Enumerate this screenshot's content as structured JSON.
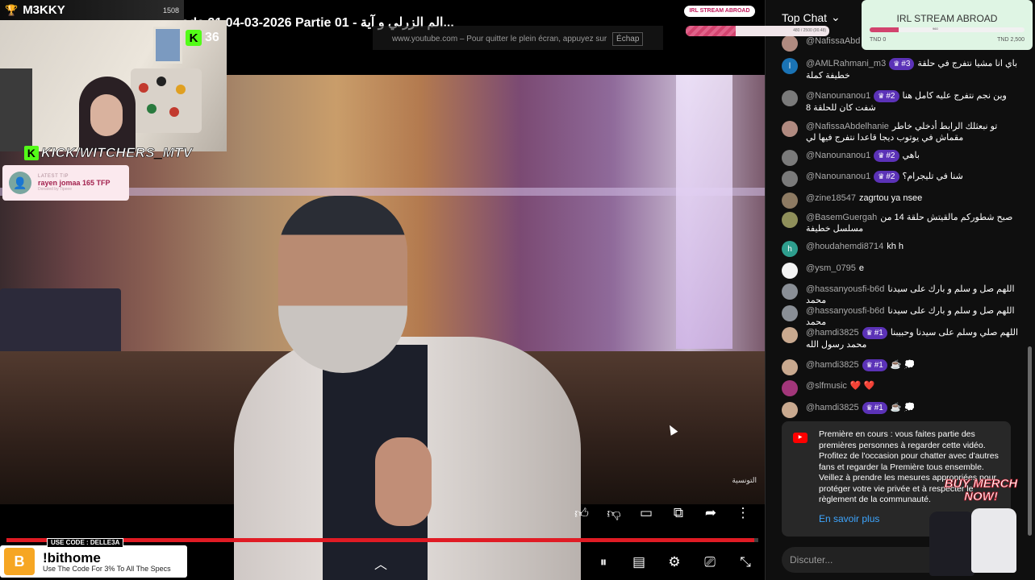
{
  "video": {
    "title": "Fekrel Sami Fehri S06 Episode 21 04-03-2026 Partie 01 - الم الزرلي و آية...",
    "fullscreen_hint": "www.youtube.com – Pour quitter le plein écran, appuyez sur",
    "fullscreen_key": "Échap",
    "watermark": "التونسية",
    "progress_pct": 99.5
  },
  "stream_overlay": {
    "streamer_name": "M3KKY",
    "streamer_count": "1508",
    "kick_viewers": "36",
    "kick_handle": "KICK/WITCHERS_MTV",
    "latest_tip_label": "LATEST TIP",
    "latest_tip_value": "rayen jomaa 165 TFP",
    "latest_tip_sub": "Donated by Tipeee",
    "irl_mini_title": "IRL STREAM ABROAD",
    "irl_mini_amount": "480 / 2500 (00.48)",
    "irl_mini_pct": 35,
    "irl_title": "IRL STREAM ABROAD",
    "irl_bar_text": "960",
    "irl_pct": 19,
    "irl_min": "TND 0",
    "irl_max": "TND 2,500"
  },
  "promo": {
    "use_code": "USE CODE : DELLE3A",
    "brand": "!bithome",
    "tagline": "Use The Code For 3% To All The Specs",
    "logo_text": "B"
  },
  "chat": {
    "header": "Top Chat",
    "messages": [
      {
        "user": "@NafissaAbd",
        "badge": "",
        "text": "",
        "avatar_color": "#b08a80"
      },
      {
        "user": "@AMLRahmani_m3",
        "badge": "#3",
        "text": "باي انا مشيا نتفرج في حلقة خطيفة كملة",
        "avatar_color": "#1a73b5",
        "avatar_letter": "l"
      },
      {
        "user": "@Nanounanou1",
        "badge": "#2",
        "text": "وين نجم نتفرج عليه كامل هنا شفت كان للحلقة 8",
        "avatar_color": "#7a7a7a"
      },
      {
        "user": "@NafissaAbdelhanie",
        "badge": "",
        "text": "تو نبعثلك الرابط أدخلي خاطر مقماش في يوتوب ديجا قاعدا نتفرج فيها لي",
        "avatar_color": "#b08a80"
      },
      {
        "user": "@Nanounanou1",
        "badge": "#2",
        "text": "باهي",
        "avatar_color": "#7a7a7a"
      },
      {
        "user": "@Nanounanou1",
        "badge": "#2",
        "text": "شنا في تليجرام؟",
        "avatar_color": "#7a7a7a"
      },
      {
        "user": "@zine18547",
        "badge": "",
        "text": "zagrtou ya nsee",
        "avatar_color": "#8d7a62"
      },
      {
        "user": "@BasemGuergah",
        "badge": "",
        "text": "صبح شطوركم مالقيتش حلقة 14 من مسلسل خطيفة",
        "avatar_color": "#8f8f5a"
      },
      {
        "user": "@houdahemdi8714",
        "badge": "",
        "text": "kh h",
        "avatar_color": "#2e9e8e",
        "avatar_letter": "h"
      },
      {
        "user": "@ysm_0795",
        "badge": "",
        "text": "e",
        "avatar_color": "#f3f3f3"
      },
      {
        "user": "@hassanyousfi-b6d",
        "badge": "",
        "text": "اللهم صل و سلم و بارك على سيدنا محمد",
        "avatar_color": "#8a8f96"
      },
      {
        "user": "@hassanyousfi-b6d",
        "badge": "",
        "text": "اللهم صل و سلم و بارك على سيدنا محمد",
        "avatar_color": "#8a8f96"
      },
      {
        "user": "@hamdi3825",
        "badge": "#1",
        "text": "اللهم صلي وسلم على سيدنا وحبيبنا محمد رسول الله",
        "avatar_color": "#c9a98f"
      },
      {
        "user": "@hamdi3825",
        "badge": "#1",
        "text": "☕ 💭",
        "avatar_color": "#c9a98f"
      },
      {
        "user": "@slfmusic",
        "badge": "",
        "text": "❤️ ❤️",
        "avatar_color": "#a2367a"
      },
      {
        "user": "@hamdi3825",
        "badge": "#1",
        "text": "☕ 💭",
        "avatar_color": "#c9a98f"
      }
    ],
    "premiere_text": "Première en cours : vous faites partie des premières personnes à regarder cette vidéo. Profitez de l'occasion pour chatter avec d'autres fans et regarder la Première tous ensemble. Veillez à prendre les mesures appropriées pour protéger votre vie privée et à respecter le règlement de la communauté.",
    "premiere_link": "En savoir plus",
    "input_placeholder": "Discuter...",
    "merch_label": "BUY MERCH NOW!"
  },
  "icons": [
    "trophy-icon",
    "like-icon",
    "dislike-icon",
    "comment-icon",
    "chat-icon",
    "share-icon",
    "more-icon",
    "chevron-up-icon",
    "pause-icon",
    "subtitles-icon",
    "settings-icon",
    "cast-icon",
    "exit-fullscreen-icon",
    "emoji-icon",
    "youtube-icon",
    "crown-icon",
    "chevron-down-icon"
  ]
}
